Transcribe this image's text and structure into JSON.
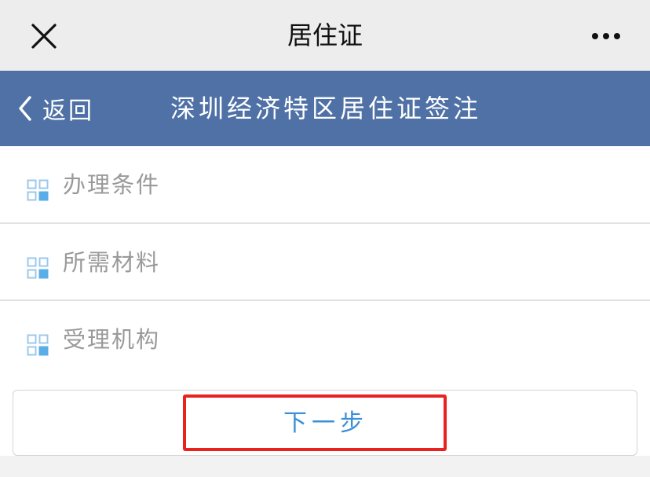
{
  "topbar": {
    "title": "居住证",
    "close_icon": "close-icon",
    "more_icon": "more-icon"
  },
  "navbar": {
    "back_label": "返回",
    "title": "深圳经济特区居住证签注",
    "background": "#4f71a6"
  },
  "menu": {
    "items": [
      {
        "label": "办理条件",
        "icon": "grid-icon"
      },
      {
        "label": "所需材料",
        "icon": "grid-icon"
      },
      {
        "label": "受理机构",
        "icon": "grid-icon"
      }
    ]
  },
  "next_button": {
    "label": "下一步",
    "color": "#3a8fd8"
  },
  "highlight": {
    "color": "#e8231f"
  }
}
